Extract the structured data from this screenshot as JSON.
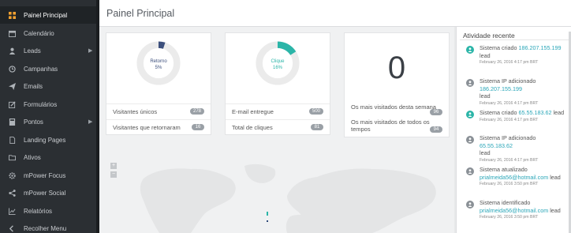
{
  "colors": {
    "sidebar_bg": "#2b2f33",
    "accent_teal": "#2bb5a8",
    "accent_navy": "#3c4f7c",
    "link": "#2aa6b8",
    "badge": "#9aa0a6"
  },
  "sidebar": {
    "items": [
      {
        "label": "Painel Principal",
        "icon": "dashboard-icon",
        "active": true,
        "has_submenu": false
      },
      {
        "label": "Calendário",
        "icon": "calendar-icon",
        "active": false,
        "has_submenu": false
      },
      {
        "label": "Leads",
        "icon": "user-icon",
        "active": false,
        "has_submenu": true
      },
      {
        "label": "Campanhas",
        "icon": "clock-icon",
        "active": false,
        "has_submenu": false
      },
      {
        "label": "Emails",
        "icon": "send-icon",
        "active": false,
        "has_submenu": false
      },
      {
        "label": "Formulários",
        "icon": "edit-form-icon",
        "active": false,
        "has_submenu": false
      },
      {
        "label": "Pontos",
        "icon": "calculator-icon",
        "active": false,
        "has_submenu": true
      },
      {
        "label": "Landing Pages",
        "icon": "file-icon",
        "active": false,
        "has_submenu": false
      },
      {
        "label": "Ativos",
        "icon": "folder-icon",
        "active": false,
        "has_submenu": false
      },
      {
        "label": "mPower Focus",
        "icon": "gear-icon",
        "active": false,
        "has_submenu": false
      },
      {
        "label": "mPower Social",
        "icon": "share-icon",
        "active": false,
        "has_submenu": false
      },
      {
        "label": "Relatórios",
        "icon": "chart-icon",
        "active": false,
        "has_submenu": false
      },
      {
        "label": "Recolher Menu",
        "icon": "collapse-icon",
        "active": false,
        "has_submenu": false
      }
    ]
  },
  "header": {
    "title": "Painel Principal"
  },
  "cards": {
    "visitors": {
      "donut_label": "Retorno",
      "donut_value": "5%",
      "donut_fraction": 0.05,
      "donut_color": "#3c4f7c",
      "rows": [
        {
          "label": "Visitantes únicos",
          "badge": "278"
        },
        {
          "label": "Visitantes que retornaram",
          "badge": "16"
        }
      ]
    },
    "email": {
      "donut_label": "Clique",
      "donut_value": "16%",
      "donut_fraction": 0.16,
      "donut_color": "#2bb5a8",
      "rows": [
        {
          "label": "E-mail entregue",
          "badge": "500"
        },
        {
          "label": "Total de cliques",
          "badge": "81"
        }
      ]
    },
    "most_visited": {
      "big_number": "0",
      "row1_label": "Os mais visitados desta semana",
      "row1_badge": "96",
      "row2_label": "Os mais visitados de todos os tempos",
      "row2_badge": "94"
    }
  },
  "map": {
    "zoom_in": "+",
    "zoom_out": "−"
  },
  "activity": {
    "title": "Atividade recente",
    "items": [
      {
        "icon": "user-add-icon",
        "color": "#2bb5a8",
        "text": "Sistema criado",
        "link": "186.207.155.199",
        "suffix": "lead",
        "date": "February 26, 2016 4:17 pm BRT"
      },
      {
        "icon": "user-icon",
        "color": "#8a9096",
        "text": "Sistema IP adicionado",
        "link": "186.207.155.199",
        "suffix": "lead",
        "date": "February 26, 2016 4:17 pm BRT"
      },
      {
        "icon": "user-add-icon",
        "color": "#2bb5a8",
        "text": "Sistema criado",
        "link": "65.55.183.62",
        "suffix": "lead",
        "date": "February 26, 2016 4:17 pm BRT"
      },
      {
        "icon": "user-icon",
        "color": "#8a9096",
        "text": "Sistema IP adicionado",
        "link": "65.55.183.62",
        "suffix": "lead",
        "date": "February 26, 2016 4:17 pm BRT"
      },
      {
        "icon": "user-icon",
        "color": "#8a9096",
        "text": "Sistema atualizado",
        "link": "prialmeida56@hotmail.com",
        "suffix": "lead",
        "date": "February 26, 2016 3:50 pm BRT"
      },
      {
        "icon": "user-icon",
        "color": "#8a9096",
        "text": "Sistema identificado",
        "link": "prialmeida56@hotmail.com",
        "suffix": "lead",
        "date": "February 26, 2016 3:50 pm BRT"
      }
    ]
  }
}
